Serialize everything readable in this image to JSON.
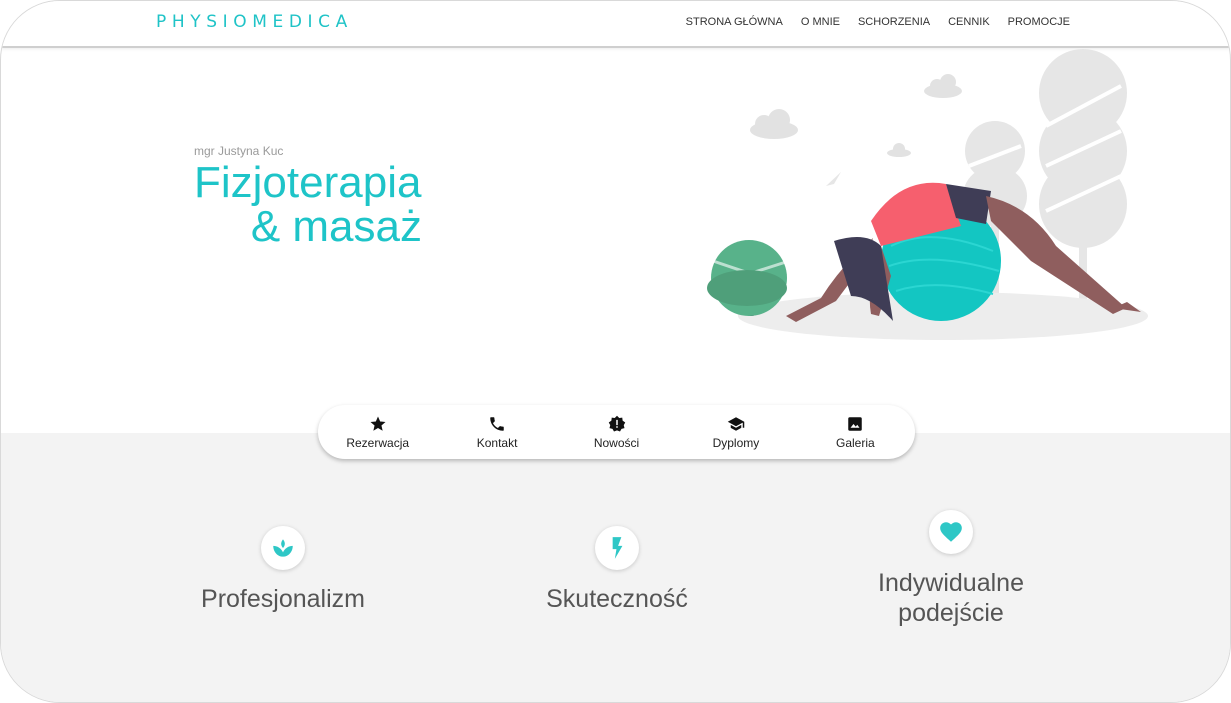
{
  "header": {
    "logo": "PHYSIOMEDICA",
    "nav": [
      "STRONA GŁÓWNA",
      "O MNIE",
      "SCHORZENIA",
      "CENNIK",
      "PROMOCJE"
    ]
  },
  "hero": {
    "subtitle": "mgr Justyna Kuc",
    "title_line1": "Fizjoterapia",
    "title_line2": "& masaż"
  },
  "quick_nav": [
    {
      "label": "Rezerwacja",
      "icon": "star-icon"
    },
    {
      "label": "Kontakt",
      "icon": "phone-icon"
    },
    {
      "label": "Nowości",
      "icon": "new-badge-icon"
    },
    {
      "label": "Dyplomy",
      "icon": "graduation-cap-icon"
    },
    {
      "label": "Galeria",
      "icon": "image-icon"
    }
  ],
  "features": [
    {
      "title": "Profesjonalizm",
      "icon": "spa-icon"
    },
    {
      "title": "Skuteczność",
      "icon": "lightning-icon"
    },
    {
      "title": "Indywidualne podejście",
      "icon": "heart-icon"
    }
  ],
  "colors": {
    "accent": "#1ec4c8",
    "grey_background": "#f3f3f3"
  }
}
